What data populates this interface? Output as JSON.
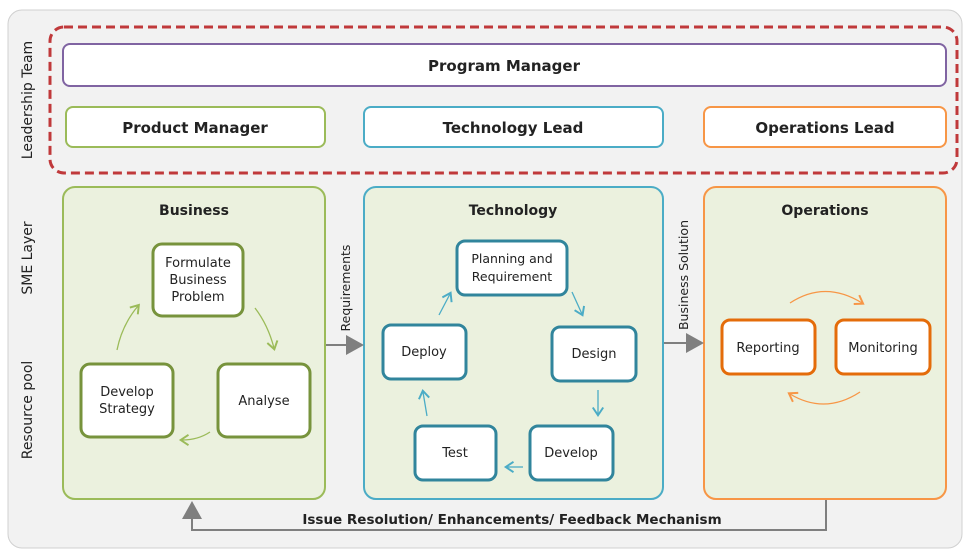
{
  "side_labels": {
    "leadership": "Leadership  Team",
    "sme": "SME Layer",
    "resource": "Resource pool"
  },
  "leadership": {
    "program_manager": "Program Manager",
    "product_manager": "Product Manager",
    "technology_lead": "Technology Lead",
    "operations_lead": "Operations Lead"
  },
  "business": {
    "title": "Business",
    "steps": [
      "Formulate",
      "Business",
      "Problem",
      "Analyse",
      "Develop",
      "Strategy"
    ]
  },
  "technology": {
    "title": "Technology",
    "planning": [
      "Planning and",
      "Requirement"
    ],
    "design": "Design",
    "develop": "Develop",
    "test": "Test",
    "deploy": "Deploy"
  },
  "operations": {
    "title": "Operations",
    "reporting": "Reporting",
    "monitoring": "Monitoring"
  },
  "connectors": {
    "requirements": "Requirements",
    "business_solution": "Business Solution",
    "feedback": "Issue Resolution/ Enhancements/ Feedback Mechanism"
  },
  "colors": {
    "leadership_border": "#c0393b",
    "program": "#8064a2",
    "business": "#9bbb59",
    "technology": "#4bacc6",
    "operations": "#f79646",
    "panel_fill": "#ebf1de"
  }
}
